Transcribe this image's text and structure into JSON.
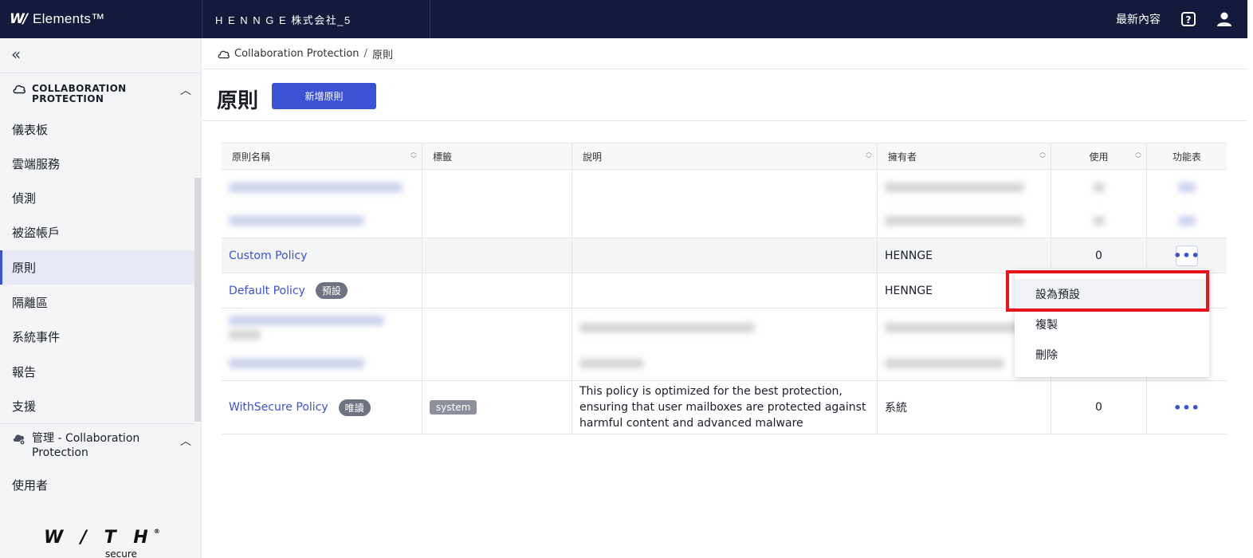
{
  "topbar": {
    "logo_mark": "W/",
    "logo_text": "Elements™",
    "org_name": "H E N N G E 株式会社_5",
    "whats_new": "最新內容",
    "help_icon": "help-icon",
    "user_icon": "user-icon",
    "bg_color": "#131a3c"
  },
  "sidebar": {
    "collapse_icon": "«",
    "section1_title": "COLLABORATION PROTECTION",
    "items": [
      {
        "label": "儀表板"
      },
      {
        "label": "雲端服務"
      },
      {
        "label": "偵測"
      },
      {
        "label": "被盜帳戶"
      },
      {
        "label": "原則"
      },
      {
        "label": "隔離區"
      },
      {
        "label": "系統事件"
      },
      {
        "label": "報告"
      },
      {
        "label": "支援"
      }
    ],
    "active_index": 4,
    "section2_title": "管理 - Collaboration Protection",
    "section2_items": [
      {
        "label": "使用者"
      }
    ],
    "footer_logo": "W / T H",
    "footer_sub": "secure"
  },
  "breadcrumb": {
    "root": "Collaboration Protection",
    "separator": "/",
    "current": "原則"
  },
  "page": {
    "title": "原則",
    "add_button": "新增原則"
  },
  "table": {
    "headers": [
      "原則名稱",
      "標籤",
      "說明",
      "擁有者",
      "使用",
      "功能表"
    ],
    "rows": [
      {
        "name": "Custom Policy",
        "owner": "HENNGE",
        "usage": "0"
      },
      {
        "name": "Default Policy",
        "badge": "預設",
        "owner": "HENNGE"
      },
      {
        "name": "WithSecure Policy",
        "badge": "唯讀",
        "tag": "system",
        "description": "This policy is optimized for the best protection, ensuring that user mailboxes are protected against harmful content and advanced malware",
        "owner": "系統",
        "usage": "0"
      }
    ],
    "menu_glyph": "•••"
  },
  "context_menu": {
    "items": [
      "設為預設",
      "複製",
      "刪除"
    ]
  },
  "colors": {
    "accent": "#3b52d4",
    "highlight_box": "#e8121a"
  }
}
